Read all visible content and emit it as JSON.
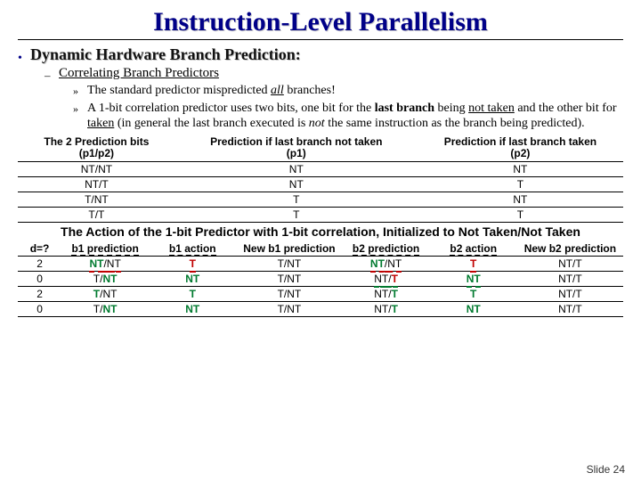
{
  "title": "Instruction-Level Parallelism",
  "section": "Dynamic Hardware Branch Prediction:",
  "subsection": "Correlating Branch Predictors",
  "point1_a": "The standard predictor mispredicted ",
  "point1_all": "all",
  "point1_b": " branches!",
  "point2_a": "A 1-bit correlation predictor uses two bits, one bit for the ",
  "point2_lb": "last branch",
  "point2_b": " being ",
  "point2_nt": "not taken",
  "point2_c": " and the other bit for ",
  "point2_t": "taken",
  "point2_d": " (in general the last branch executed is ",
  "point2_not": "not",
  "point2_e": " the same instruction as the branch being predicted).",
  "tbl1": {
    "h1a": "The 2 Prediction bits",
    "h1b": "(p1/p2)",
    "h2a": "Prediction if last branch not taken",
    "h2b": "(p1)",
    "h3a": "Prediction if last branch taken",
    "h3b": "(p2)",
    "rows": [
      [
        "NT/NT",
        "NT",
        "NT"
      ],
      [
        "NT/T",
        "NT",
        "T"
      ],
      [
        "T/NT",
        "T",
        "NT"
      ],
      [
        "T/T",
        "T",
        "T"
      ]
    ]
  },
  "caption": "The Action of the 1-bit Predictor with 1-bit correlation, Initialized to Not Taken/Not Taken",
  "tbl2": {
    "headers": [
      "d=?",
      "b1 prediction",
      "b1 action",
      "New b1 prediction",
      "b2 prediction",
      "b2 action",
      "New b2 prediction"
    ],
    "rows": [
      {
        "d": "2",
        "b1p_a": "NT",
        "b1p_b": "/NT",
        "b1a": "T",
        "nb1": "T/NT",
        "b2p_a": "NT",
        "b2p_b": "/NT",
        "b2a": "T",
        "nb2": "NT/T"
      },
      {
        "d": "0",
        "b1p_a": "T/",
        "b1p_b": "NT",
        "b1a": "NT",
        "nb1": "T/NT",
        "b2p_a": "NT/",
        "b2p_b": "T",
        "b2a": "NT",
        "nb2": "NT/T"
      },
      {
        "d": "2",
        "b1p_a": "T",
        "b1p_b": "/NT",
        "b1a": "T",
        "nb1": "T/NT",
        "b2p_a": "NT/",
        "b2p_b": "T",
        "b2a": "T",
        "nb2": "NT/T"
      },
      {
        "d": "0",
        "b1p_a": "T/",
        "b1p_b": "NT",
        "b1a": "NT",
        "nb1": "T/NT",
        "b2p_a": "NT/",
        "b2p_b": "T",
        "b2a": "NT",
        "nb2": "NT/T"
      }
    ]
  },
  "slide_number": "Slide 24"
}
